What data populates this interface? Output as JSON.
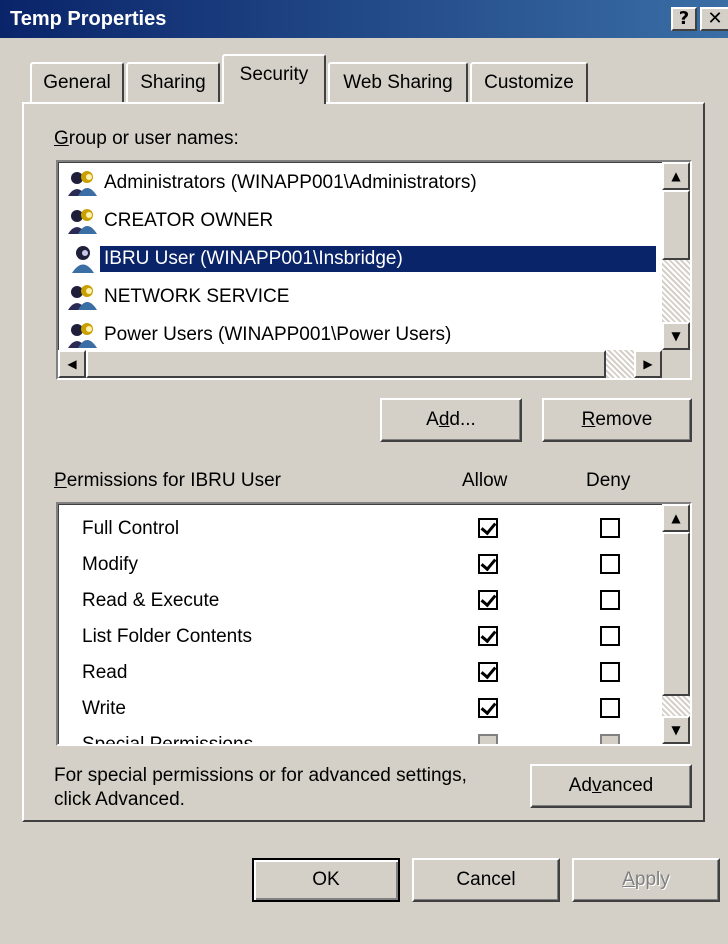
{
  "window": {
    "title": "Temp Properties",
    "help_glyph": "?",
    "close_glyph": "✕"
  },
  "tabs": [
    {
      "label": "General",
      "active": false
    },
    {
      "label": "Sharing",
      "active": false
    },
    {
      "label": "Security",
      "active": true
    },
    {
      "label": "Web Sharing",
      "active": false
    },
    {
      "label": "Customize",
      "active": false
    }
  ],
  "groups": {
    "label_prefix": "G",
    "label_rest": "roup or user names:",
    "items": [
      {
        "label": "Administrators (WINAPP001\\Administrators)",
        "icon": "user-group-icon",
        "selected": false
      },
      {
        "label": "CREATOR OWNER",
        "icon": "user-group-icon",
        "selected": false
      },
      {
        "label": "IBRU User (WINAPP001\\Insbridge)",
        "icon": "user-icon",
        "selected": true
      },
      {
        "label": "NETWORK SERVICE",
        "icon": "user-group-icon",
        "selected": false
      },
      {
        "label": "Power Users (WINAPP001\\Power Users)",
        "icon": "user-group-icon",
        "selected": false
      }
    ]
  },
  "buttons": {
    "add_pre": "A",
    "add_u": "d",
    "add_post": "d...",
    "remove_u": "R",
    "remove_post": "emove",
    "advanced_pre": "Ad",
    "advanced_u": "v",
    "advanced_post": "anced",
    "ok": "OK",
    "cancel": "Cancel",
    "apply_u": "A",
    "apply_post": "pply"
  },
  "permissions": {
    "label_u": "P",
    "label_rest": "ermissions for IBRU User",
    "allow_header": "Allow",
    "deny_header": "Deny",
    "rows": [
      {
        "label": "Full Control",
        "allow": true,
        "deny": false
      },
      {
        "label": "Modify",
        "allow": true,
        "deny": false
      },
      {
        "label": "Read & Execute",
        "allow": true,
        "deny": false
      },
      {
        "label": "List Folder Contents",
        "allow": true,
        "deny": false
      },
      {
        "label": "Read",
        "allow": true,
        "deny": false
      },
      {
        "label": "Write",
        "allow": true,
        "deny": false
      },
      {
        "label": "Special Permissions",
        "allow": false,
        "deny": false
      }
    ]
  },
  "advanced_note": {
    "line1": "For special permissions or for advanced settings,",
    "line2": "click Advanced."
  },
  "colors": {
    "selection": "#0a246a",
    "face": "#d4d0c8"
  }
}
